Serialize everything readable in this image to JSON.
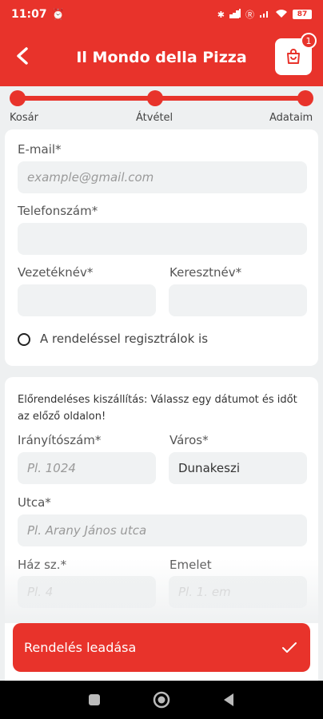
{
  "status": {
    "time": "11:07",
    "battery": "87"
  },
  "header": {
    "title": "Il Mondo della Pizza",
    "cart_count": "1"
  },
  "steps": [
    "Kosár",
    "Átvétel",
    "Adataim"
  ],
  "contact": {
    "email_label": "E-mail*",
    "email_placeholder": "example@gmail.com",
    "phone_label": "Telefonszám*",
    "lastname_label": "Vezetéknév*",
    "firstname_label": "Keresztnév*",
    "register_label": "A rendeléssel regisztrálok is"
  },
  "delivery": {
    "note": "Előrendeléses kiszállítás: Válassz egy dátumot és időt az előző oldalon!",
    "zip_label": "Irányítószám*",
    "zip_placeholder": "Pl. 1024",
    "city_label": "Város*",
    "city_value": "Dunakeszi",
    "street_label": "Utca*",
    "street_placeholder": "Pl. Arany János utca",
    "house_label": "Ház sz.*",
    "house_placeholder": "Pl. 4",
    "floor_label": "Emelet",
    "floor_placeholder": "Pl. 1. em"
  },
  "submit_label": "Rendelés leadása"
}
